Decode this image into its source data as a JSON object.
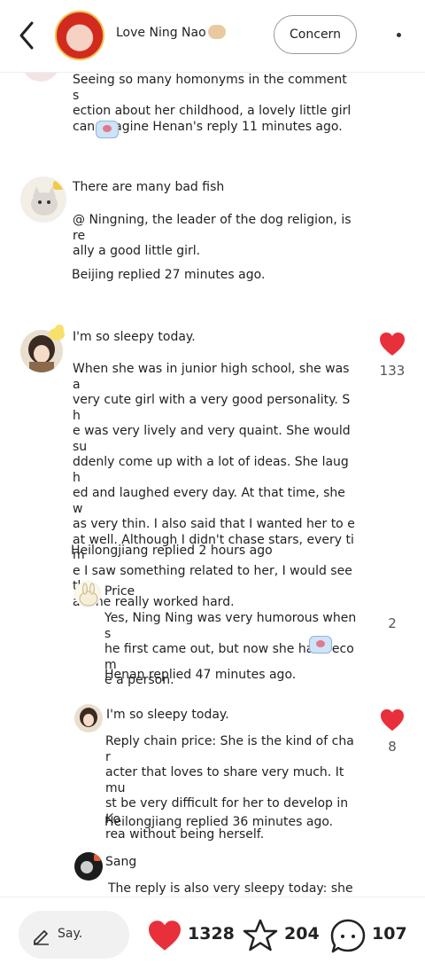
{
  "header": {
    "title": "Love Ning Nao",
    "follow_label": "Concern"
  },
  "comments": [
    {
      "text": "Seeing so many homonyms in the comment s\nection about her childhood, a lovely little girl\ncan imagine Henan's reply 11 minutes ago."
    },
    {
      "name": "There are many bad fish",
      "text": "@ Ningning, the leader of the dog religion, is re\nally a good little girl.",
      "meta": "Beijing replied 27 minutes ago."
    },
    {
      "name": "I'm so sleepy today.",
      "text": "When she was in junior high school, she was a\nvery cute girl with a very good personality. Sh\ne was very lively and very quaint. She would su\nddenly come up with a lot of ideas. She laugh\ned and laughed every day. At that time, she w\nas very thin. I also said that I wanted her to e\nat well. Although I didn't chase stars, every tim\ne I saw something related to her, I would see th\nat she really worked hard.",
      "meta": "Heilongjiang replied 2 hours ago",
      "likes": "133",
      "liked": true
    }
  ],
  "replies": [
    {
      "name": "Price",
      "text": "Yes, Ning Ning was very humorous when s\nhe first came out, but now she has becom\ne a person.",
      "meta": "Henan replied 47 minutes ago.",
      "likes": "2",
      "liked": false
    },
    {
      "name": "I'm so sleepy today.",
      "text": "Reply chain price: She is the kind of char\nacter that loves to share very much. It mu\nst be very difficult for her to develop in Ko\nrea without being herself.",
      "meta": "Heilongjiang replied 36 minutes ago.",
      "likes": "8",
      "liked": true
    },
    {
      "name": "Sang",
      "text": "The reply is also very sleepy today: she w\nas there before."
    }
  ],
  "bottom": {
    "say_label": "Say.",
    "likes": "1328",
    "favorites": "204",
    "comments": "107"
  },
  "colors": {
    "like_red": "#e8303a"
  }
}
